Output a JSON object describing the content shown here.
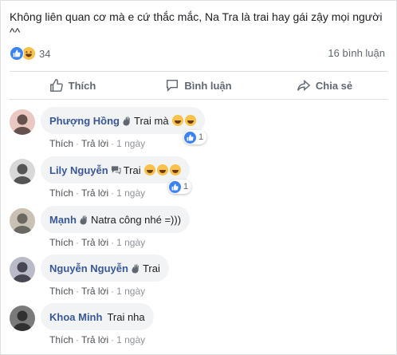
{
  "post": {
    "text": "Không liên quan cơ mà e cứ thắc mắc, Na Tra là trai hay gái zậy mọi người ^^",
    "reaction_count": "34",
    "comment_count": "16 bình luận"
  },
  "actions": {
    "like": "Thích",
    "comment": "Bình luận",
    "share": "Chia sẻ"
  },
  "colors": {
    "name": "#385898",
    "like_blue": "#3b82f6",
    "bubble_bg": "#f2f3f5",
    "meta_gray": "#90949c"
  },
  "comments": [
    {
      "name": "Phượng Hồng",
      "badge_icon": "wave-icon",
      "text": "Trai mà",
      "emoji_count": 2,
      "reactions": "1",
      "like": "Thích",
      "reply": "Trả lời",
      "age": "1 ngày"
    },
    {
      "name": "Lily Nguyễn",
      "badge_icon": "chat-icon",
      "text": "Trai",
      "emoji_count": 3,
      "reactions": "1",
      "like": "Thích",
      "reply": "Trả lời",
      "age": "1 ngày"
    },
    {
      "name": "Mạnh",
      "badge_icon": "wave-icon",
      "text": "Natra công nhé =)))",
      "emoji_count": 0,
      "like": "Thích",
      "reply": "Trả lời",
      "age": "1 ngày"
    },
    {
      "name": "Nguyễn Nguyễn",
      "badge_icon": "wave-icon",
      "text": "Trai",
      "emoji_count": 0,
      "like": "Thích",
      "reply": "Trả lời",
      "age": "1 ngày"
    },
    {
      "name": "Khoa Minh",
      "text": "Trai nha",
      "emoji_count": 0,
      "like": "Thích",
      "reply": "Trả lời",
      "age": "1 ngày"
    }
  ]
}
